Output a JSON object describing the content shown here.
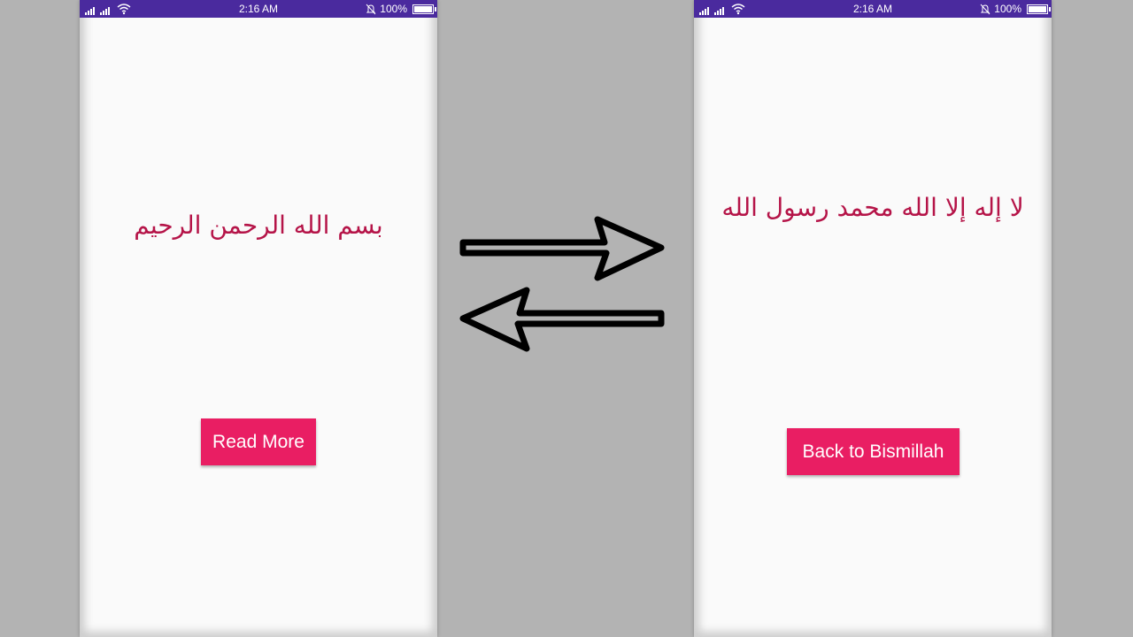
{
  "status_bar": {
    "time": "2:16 AM",
    "battery": "100%"
  },
  "screen_left": {
    "arabic_text": "بسم الله الرحمن الرحيم",
    "button_label": "Read More"
  },
  "screen_right": {
    "arabic_text": "لا إله إلا الله محمد رسول الله",
    "button_label": "Back to Bismillah"
  },
  "icons": [
    "signal-icon",
    "wifi-icon",
    "bell-off-icon",
    "battery-icon",
    "arrow-right-icon",
    "arrow-left-icon"
  ],
  "colors": {
    "status_bar": "#4a2a9e",
    "arabic_text": "#b51448",
    "button": "#e91e63",
    "screen_bg": "#fafafa",
    "page_bg": "#b3b3b3"
  }
}
